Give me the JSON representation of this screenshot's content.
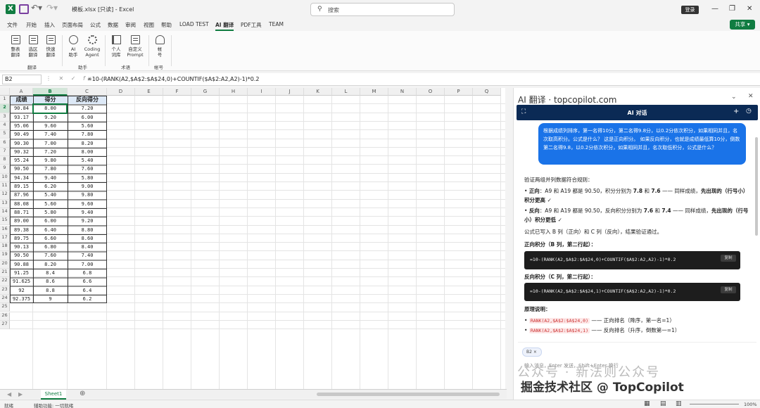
{
  "window": {
    "title": "模板.xlsx [只读] - Excel",
    "search_placeholder": "搜索",
    "login_label": "登录",
    "share_label": "共享 ▾"
  },
  "menu": [
    "文件",
    "开始",
    "插入",
    "页面布局",
    "公式",
    "数据",
    "审阅",
    "视图",
    "帮助",
    "LOAD TEST",
    "AI 翻译",
    "PDF工具",
    "TEAM"
  ],
  "ribbon": {
    "buttons": [
      {
        "l1": "整表",
        "l2": "翻译",
        "icon": "doc-translate-icon"
      },
      {
        "l1": "选区",
        "l2": "翻译",
        "icon": "selection-translate-icon"
      },
      {
        "l1": "快速",
        "l2": "翻译",
        "icon": "quick-translate-icon"
      },
      {
        "l1": "AI",
        "l2": "助手",
        "icon": "robot-icon"
      },
      {
        "l1": "Coding",
        "l2": "Agent",
        "icon": "agent-icon"
      },
      {
        "l1": "个人",
        "l2": "词库",
        "icon": "book-icon"
      },
      {
        "l1": "自定义",
        "l2": "Prompt",
        "icon": "prompt-icon"
      },
      {
        "l1": "帐",
        "l2": "号",
        "icon": "account-icon"
      }
    ],
    "groups": [
      "翻译",
      "助手",
      "术语",
      "帐号"
    ]
  },
  "formula_bar": {
    "name_box": "B2",
    "formula": "=10-(RANK(A2,$A$2:$A$24,0)+COUNTIF($A$2:A2,A2)-1)*0.2"
  },
  "grid": {
    "columns": [
      "A",
      "B",
      "C",
      "D",
      "E",
      "F",
      "G",
      "H",
      "I",
      "J",
      "K",
      "L",
      "M",
      "N",
      "O",
      "P",
      "Q"
    ],
    "row_count": 27,
    "headers": [
      "成绩",
      "得分",
      "反向得分"
    ],
    "rows": [
      [
        "90.84",
        "8.00",
        "7.20"
      ],
      [
        "93.17",
        "9.20",
        "6.00"
      ],
      [
        "95.06",
        "9.60",
        "5.60"
      ],
      [
        "90.49",
        "7.40",
        "7.80"
      ],
      [
        "90.30",
        "7.00",
        "8.20"
      ],
      [
        "90.32",
        "7.20",
        "8.00"
      ],
      [
        "95.24",
        "9.80",
        "5.40"
      ],
      [
        "90.50",
        "7.80",
        "7.60"
      ],
      [
        "94.34",
        "9.40",
        "5.80"
      ],
      [
        "89.15",
        "6.20",
        "9.00"
      ],
      [
        "87.96",
        "5.40",
        "9.80"
      ],
      [
        "88.08",
        "5.60",
        "9.60"
      ],
      [
        "88.71",
        "5.80",
        "9.40"
      ],
      [
        "89.00",
        "6.00",
        "9.20"
      ],
      [
        "89.38",
        "6.40",
        "8.80"
      ],
      [
        "89.75",
        "6.60",
        "8.60"
      ],
      [
        "90.13",
        "6.80",
        "8.40"
      ],
      [
        "90.50",
        "7.60",
        "7.40"
      ],
      [
        "90.88",
        "8.20",
        "7.00"
      ],
      [
        "91.25",
        "8.4",
        "6.8"
      ],
      [
        "91.625",
        "8.6",
        "6.6"
      ],
      [
        "92",
        "8.8",
        "6.4"
      ],
      [
        "92.375",
        "9",
        "6.2"
      ]
    ]
  },
  "sheet_tab": "Sheet1",
  "status": {
    "ready": "就绪",
    "accessibility": "辅助功能: 一切就绪",
    "zoom": "100%"
  },
  "ai_panel": {
    "title": "AI 翻译 · topcopilot.com",
    "bar_title": "AI 对话",
    "user_msg": "根据成绩列排序，第一名得10分，第二名得9.8分，以0.2分依次积分，如果相同并且，名次取高积分。公式是什么？ 这是正向积分。 如果反向积分，也就是成绩最低算10分，倒数第二名得9.8，以0.2分依次积分，如果相同并且，名次取低积分，公式是什么？",
    "verify_title": "验证两组并列数据符合规则：",
    "b1_head": "正向",
    "b1_text": "：A9 和 A19 都是 90.50，积分分别为 ",
    "b1_v1": "7.8",
    "b1_mid": " 和 ",
    "b1_v2": "7.6",
    "b1_tail": " —— 同样成绩，",
    "b1_bold2": "先出现的（行号小）积分更高 ✓",
    "b2_head": "反向",
    "b2_text": "：A9 和 A19 都是 90.50，反向积分分别为 ",
    "b2_v1": "7.6",
    "b2_mid": " 和 ",
    "b2_v2": "7.4",
    "b2_tail": " —— 同样成绩，",
    "b2_bold2": "先出现的（行号小）积分更低 ✓",
    "written": "公式已写入 B 列（正向）和 C 列（反向），结果验证通过。",
    "forward_label": "正向积分（B 列，第二行起）：",
    "forward_code": "=10-(RANK(A2,$A$2:$A$24,0)+COUNTIF($A$2:A2,A2)-1)*0.2",
    "reverse_label": "反向积分（C 列，第二行起）：",
    "reverse_code": "=10-(RANK(A2,$A$2:$A$24,1)+COUNTIF($A$2:A2,A2)-1)*0.2",
    "copy_label": "复制",
    "principle_title": "原理说明：",
    "p1_code": "RANK(A2,$A$2:$A$24,0)",
    "p1_text": " —— 正向排名（降序，第一名=1）",
    "p2_code": "RANK(A2,$A$2:$A$24,1)",
    "p2_text": " —— 反向排名（升序，倒数第一=1）",
    "chip": "B2",
    "input_placeholder": "输入消息，Enter 发送，Shift+Enter 换行"
  },
  "watermark": {
    "line1": "公众号 · 新法则公众号",
    "line2": "掘金技术社区 @ TopCopilot"
  }
}
